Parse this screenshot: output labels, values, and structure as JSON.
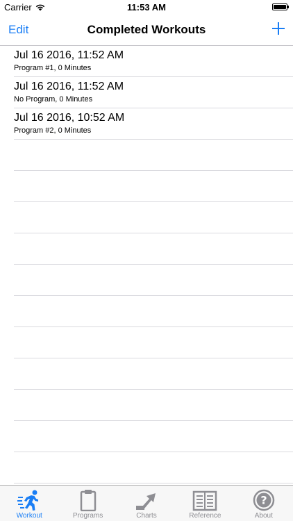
{
  "status_bar": {
    "carrier": "Carrier",
    "time": "11:53 AM"
  },
  "nav": {
    "edit_label": "Edit",
    "title": "Completed Workouts",
    "add_icon": "plus-icon"
  },
  "workouts": [
    {
      "title": "Jul 16 2016, 11:52 AM",
      "subtitle": "Program #1, 0 Minutes"
    },
    {
      "title": "Jul 16 2016, 11:52 AM",
      "subtitle": "No Program, 0 Minutes"
    },
    {
      "title": "Jul 16 2016, 10:52 AM",
      "subtitle": "Program #2, 0 Minutes"
    }
  ],
  "tabs": [
    {
      "label": "Workout",
      "icon": "running-person-icon"
    },
    {
      "label": "Programs",
      "icon": "clipboard-icon"
    },
    {
      "label": "Charts",
      "icon": "trend-arrow-icon"
    },
    {
      "label": "Reference",
      "icon": "open-book-icon"
    },
    {
      "label": "About",
      "icon": "question-mark-icon"
    }
  ],
  "active_tab": "Workout",
  "colors": {
    "accent": "#1a7ef5",
    "inactive": "#8e8e93",
    "separator": "#d9d9de"
  }
}
